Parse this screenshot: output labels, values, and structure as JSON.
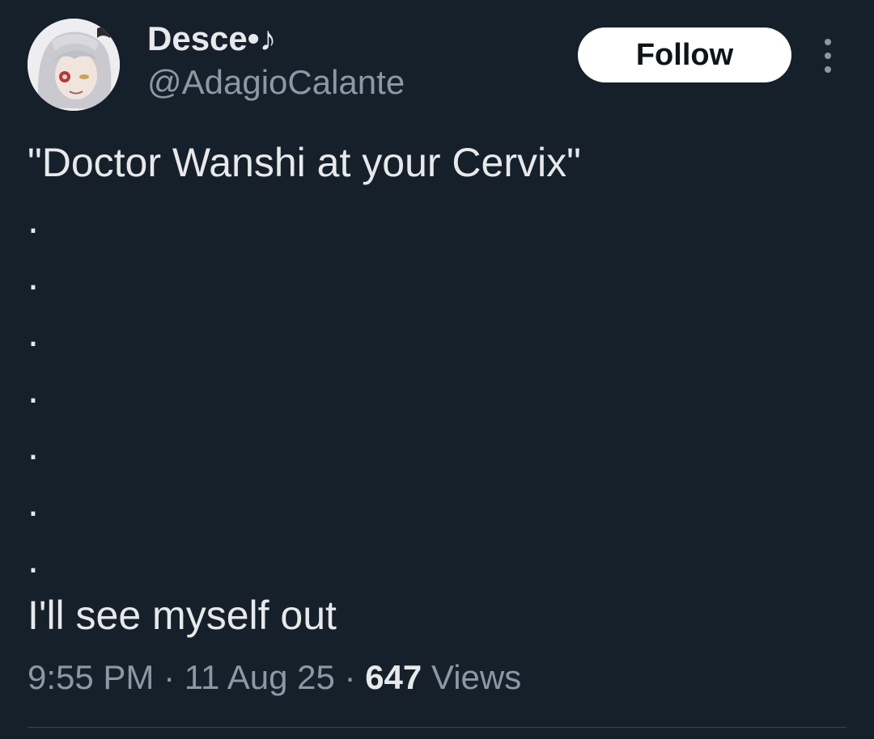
{
  "author": {
    "display_name": "Desce•♪",
    "handle": "@AdagioCalante"
  },
  "follow_button": {
    "label": "Follow"
  },
  "tweet": {
    "text": "\"Doctor Wanshi at your Cervix\"\n.\n.\n.\n.\n.\n.\n.\nI'll see myself out"
  },
  "meta": {
    "time": "9:55 PM",
    "separator": "·",
    "date": "11 Aug 25",
    "views_count": "647",
    "views_label": "Views"
  },
  "icons": {
    "more": "more-vertical-icon",
    "avatar": "user-avatar"
  },
  "colors": {
    "background": "#16202b",
    "primary_text": "#e7e9ea",
    "secondary_text": "#8b98a5",
    "follow_bg": "#ffffff",
    "follow_text": "#0f1419"
  }
}
